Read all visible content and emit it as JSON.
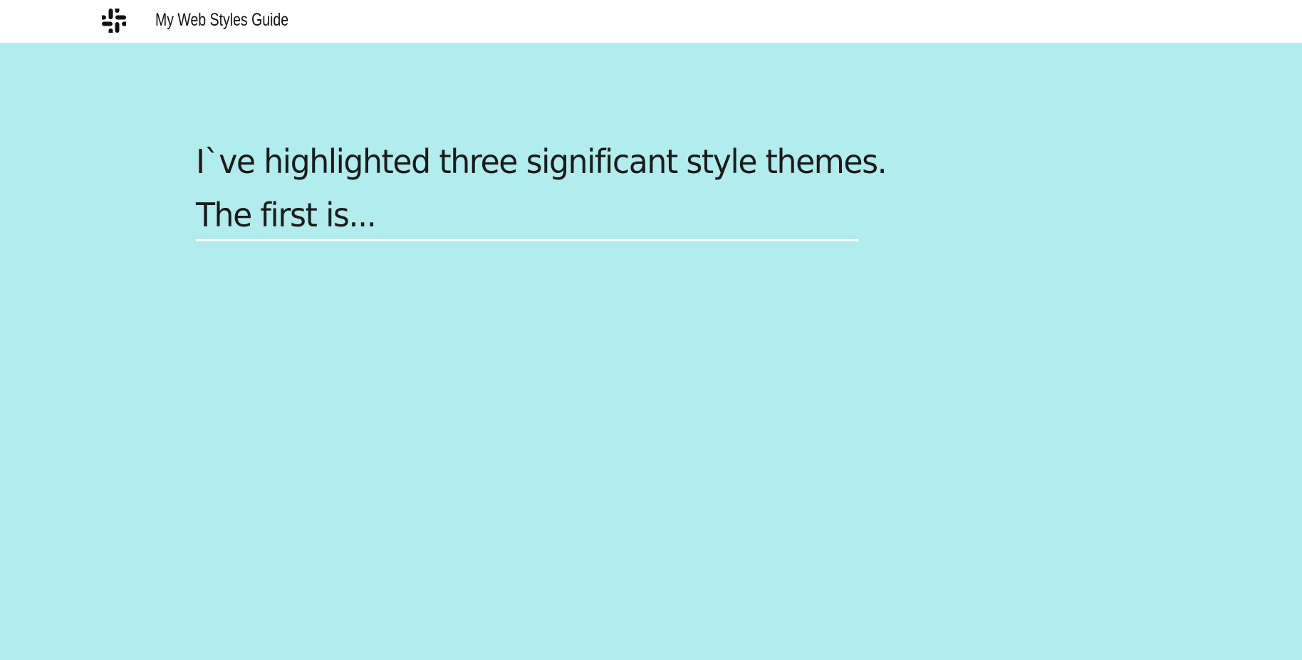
{
  "header": {
    "logo_icon": "slack-logo-icon",
    "title": "My Web Styles Guide"
  },
  "hero": {
    "background_color": "#b2eced",
    "line1": "I`ve highlighted three significant style themes.",
    "line2": "The first is..."
  }
}
